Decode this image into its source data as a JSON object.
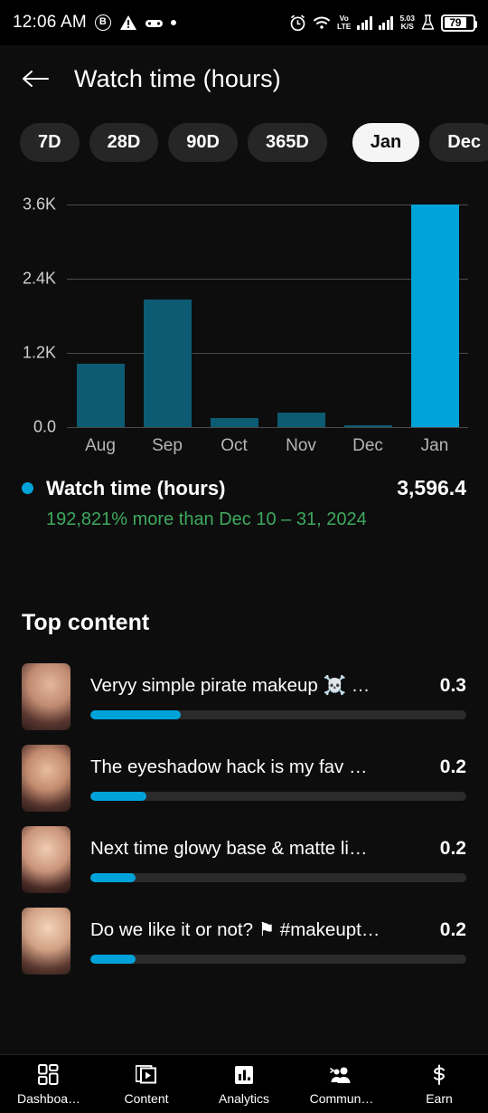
{
  "status_bar": {
    "time": "12:06 AM",
    "left_icons": [
      "circle-b-icon",
      "warning-triangle-icon",
      "gamepad-icon",
      "dot-icon"
    ],
    "alarm_icon": "alarm-icon",
    "wifi_icon": "wifi-icon",
    "volte_line1": "Vo",
    "volte_line2": "LTE",
    "signal_icon_1": "signal-bars-icon",
    "signal_icon_2": "signal-bars-icon",
    "net_speed_value": "5.03",
    "net_speed_unit": "K/S",
    "flask_icon": "flask-icon",
    "battery_level": "79"
  },
  "app_bar": {
    "back_icon": "back-arrow-icon",
    "title": "Watch time (hours)"
  },
  "filters": {
    "chips": [
      {
        "label": "7D",
        "active": false
      },
      {
        "label": "28D",
        "active": false
      },
      {
        "label": "90D",
        "active": false
      },
      {
        "label": "365D",
        "active": false
      },
      {
        "label": "Jan",
        "active": true
      },
      {
        "label": "Dec",
        "active": false
      }
    ],
    "divider_after_index": 3
  },
  "chart_data": {
    "type": "bar",
    "title": "Watch time (hours)",
    "xlabel": "",
    "ylabel": "",
    "categories": [
      "Aug",
      "Sep",
      "Oct",
      "Nov",
      "Dec",
      "Jan"
    ],
    "values": [
      1025,
      2065,
      145,
      235,
      15,
      3596.4
    ],
    "ytick_labels": [
      "0.0",
      "1.2K",
      "2.4K",
      "3.6K"
    ],
    "ytick_values": [
      0,
      1200,
      2400,
      3600
    ],
    "ylim": [
      0,
      3600
    ],
    "grid": true,
    "legend": "bottom",
    "bar_color": "#0c5b73",
    "highlight_bar_color": "#00a3d9",
    "highlight_index": 5
  },
  "summary": {
    "legend_dot_color": "#00a3d9",
    "label": "Watch time (hours)",
    "value": "3,596.4",
    "delta_text": "192,821% more than Dec 10 – 31, 2024",
    "delta_color": "#3ea95e"
  },
  "top_content": {
    "heading": "Top content",
    "items": [
      {
        "title": "Veryy simple pirate makeup ☠️ …",
        "value": "0.3",
        "progress": 24,
        "thumbnail": "creator-portrait-thumbnail"
      },
      {
        "title": "The eyeshadow hack is my fav …",
        "value": "0.2",
        "progress": 15,
        "thumbnail": "creator-portrait-thumbnail"
      },
      {
        "title": "Next time glowy base & matte li…",
        "value": "0.2",
        "progress": 12,
        "thumbnail": "creator-portrait-thumbnail"
      },
      {
        "title": "Do we like it or not? ⚑ #makeupt…",
        "value": "0.2",
        "progress": 12,
        "thumbnail": "creator-portrait-thumbnail"
      }
    ],
    "progress_fill_color": "#00a3d9",
    "progress_track_color": "#2b2b2b"
  },
  "bottom_nav": {
    "items": [
      {
        "label": "Dashboa…",
        "icon": "dashboard-icon",
        "active": false
      },
      {
        "label": "Content",
        "icon": "content-video-icon",
        "active": false
      },
      {
        "label": "Analytics",
        "icon": "analytics-bars-icon",
        "active": true
      },
      {
        "label": "Commun…",
        "icon": "community-people-icon",
        "active": false
      },
      {
        "label": "Earn",
        "icon": "earn-dollar-icon",
        "active": false
      }
    ]
  }
}
